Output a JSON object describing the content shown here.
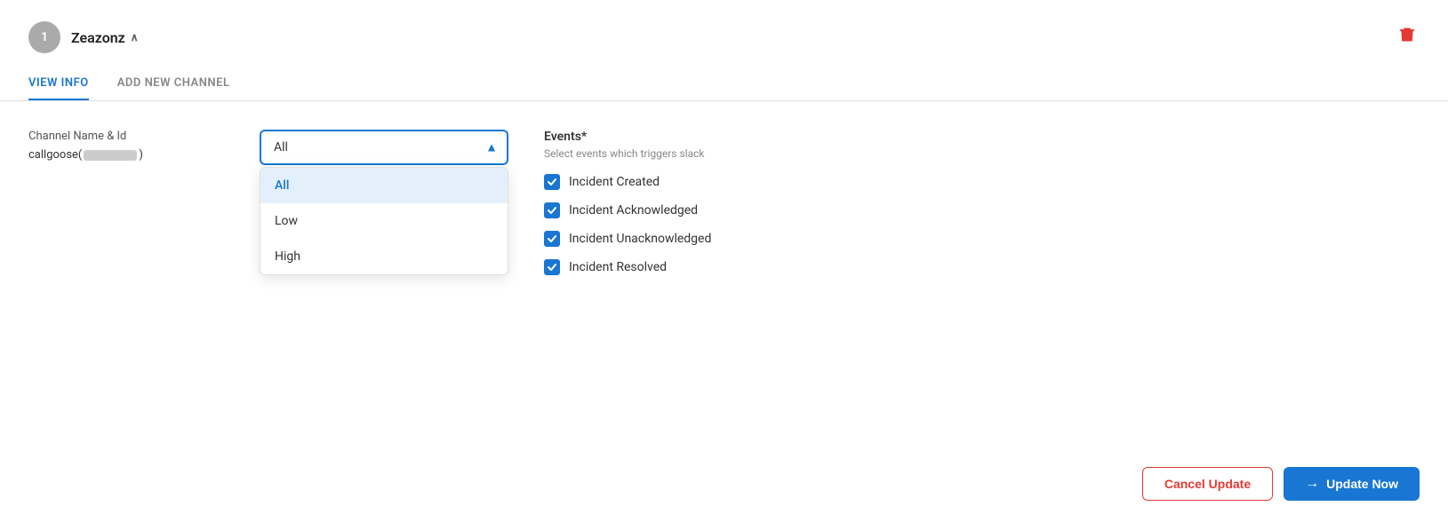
{
  "header": {
    "avatar_letter": "1",
    "user_name": "Zeazonz",
    "chevron": "∧",
    "delete_icon": "🗑"
  },
  "tabs": [
    {
      "id": "view-info",
      "label": "VIEW INFO",
      "active": true
    },
    {
      "id": "add-new-channel",
      "label": "ADD NEW CHANNEL",
      "active": false
    }
  ],
  "channel_section": {
    "label": "Channel Name & Id",
    "value_prefix": "callgoose(",
    "value_suffix": ")"
  },
  "dropdown": {
    "selected": "All",
    "options": [
      {
        "value": "all",
        "label": "All",
        "selected": true
      },
      {
        "value": "low",
        "label": "Low",
        "selected": false
      },
      {
        "value": "high",
        "label": "High",
        "selected": false
      }
    ]
  },
  "events": {
    "title": "Events*",
    "subtitle": "Select events which triggers slack",
    "items": [
      {
        "id": "incident-created",
        "label": "Incident Created",
        "checked": true
      },
      {
        "id": "incident-acknowledged",
        "label": "Incident Acknowledged",
        "checked": true
      },
      {
        "id": "incident-unacknowledged",
        "label": "Incident Unacknowledged",
        "checked": true
      },
      {
        "id": "incident-resolved",
        "label": "Incident Resolved",
        "checked": true
      }
    ]
  },
  "footer": {
    "cancel_label": "Cancel Update",
    "update_label": "Update Now",
    "update_arrow": "→"
  }
}
